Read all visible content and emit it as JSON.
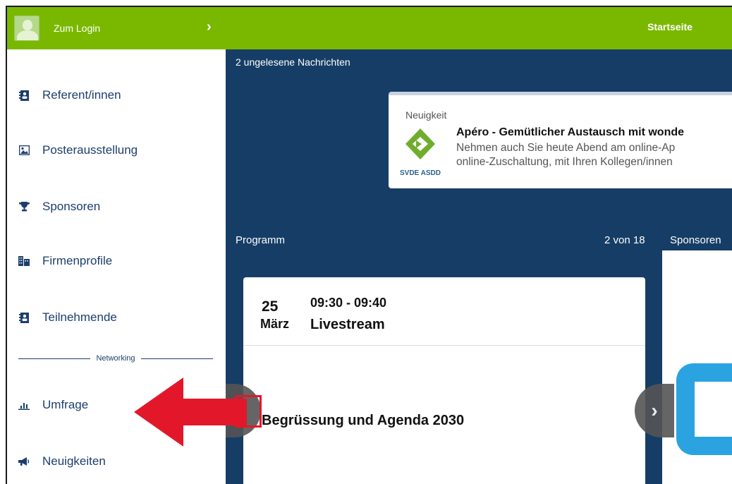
{
  "topbar": {
    "login_label": "Zum Login",
    "login_chevron": "›",
    "title": "Startseite"
  },
  "sidebar": {
    "items": [
      {
        "label": "Referent/innen",
        "icon": "address-book-icon"
      },
      {
        "label": "Posterausstellung",
        "icon": "image-icon"
      },
      {
        "label": "Sponsoren",
        "icon": "trophy-icon"
      },
      {
        "label": "Firmenprofile",
        "icon": "building-icon"
      },
      {
        "label": "Teilnehmende",
        "icon": "address-book-icon"
      },
      {
        "label": "Umfrage",
        "icon": "bar-chart-icon"
      },
      {
        "label": "Neuigkeiten",
        "icon": "megaphone-icon"
      }
    ],
    "separator": "Networking"
  },
  "main": {
    "unread": "2 ungelesene Nachrichten",
    "news": {
      "label": "Neuigkeit",
      "logo_text": "SVDE ASDD",
      "title": "Apéro - Gemütlicher Austausch mit wonde",
      "text_line1": "Nehmen auch Sie heute Abend am online-Ap",
      "text_line2": "online-Zuschaltung, mit Ihren Kollegen/innen"
    },
    "program_label": "Programm",
    "program_count": "2 von 18",
    "sponsors_label": "Sponsoren",
    "event": {
      "day": "25",
      "month": "März",
      "time": "09:30 - 09:40",
      "stream": "Livestream",
      "title": "Begrüssung und Agenda 2030"
    },
    "prev_glyph": "‹",
    "next_glyph": "›"
  },
  "colors": {
    "topbar": "#7ab800",
    "main_bg": "#163d66",
    "nav_text": "#1d3e6c",
    "annotation": "#e3172a",
    "sponsor_logo": "#2aa3e0"
  }
}
